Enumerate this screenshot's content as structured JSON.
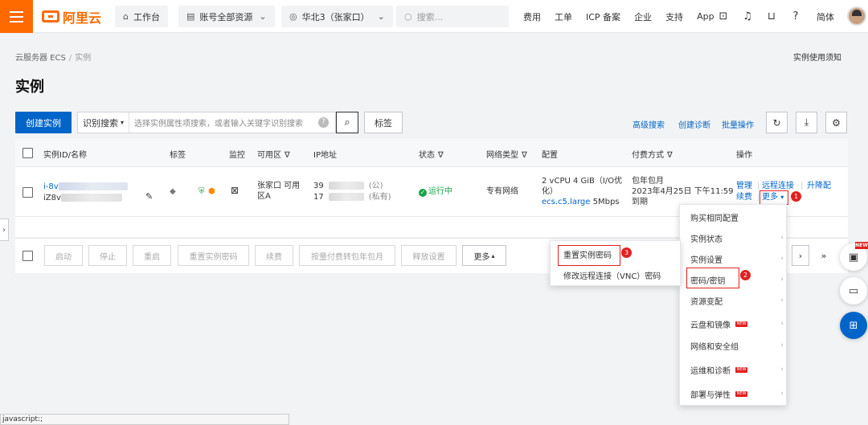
{
  "topbar": {
    "logo_text": "阿里云",
    "workbench": "工作台",
    "resources": "账号全部资源",
    "region": "华北3（张家口）",
    "search_placeholder": "搜索...",
    "links": [
      "费用",
      "工单",
      "ICP 备案",
      "企业",
      "支持",
      "App"
    ],
    "lang": "简体"
  },
  "breadcrumb": {
    "root": "云服务器 ECS",
    "sep": "/",
    "current": "实例"
  },
  "notice": "实例使用须知",
  "page_title": "实例",
  "toolbar": {
    "create": "创建实例",
    "search_select": "识别搜索",
    "search_placeholder": "选择实例属性项搜索，或者输入关键字识别搜索",
    "help": "?",
    "tag": "标签",
    "advanced": "高级搜索",
    "diagnose": "创建诊断",
    "batch": "批量操作"
  },
  "table": {
    "headers": [
      "实例ID/名称",
      "标签",
      "监控",
      "可用区",
      "IP地址",
      "状态",
      "网络类型",
      "配置",
      "付费方式",
      "操作"
    ],
    "row": {
      "id_prefix": "i-8v",
      "name_prefix": "iZ8v",
      "zone_line1": "张家口 可用",
      "zone_line2": "区A",
      "ip1_prefix": "39",
      "ip1_suffix": "(公)",
      "ip2_prefix": "17",
      "ip2_suffix": "(私有)",
      "status": "运行中",
      "network": "专有网络",
      "config_line1": "2 vCPU 4 GiB（I/O优",
      "config_line2": "化）",
      "config_type": "ecs.c5.large",
      "bandwidth": "5Mbps",
      "billing_line1": "包年包月",
      "billing_line2": "2023年4月25日 下午11:59",
      "billing_line3": "到期",
      "ops": {
        "manage": "管理",
        "remote": "远程连接",
        "upgrade": "升降配",
        "renew": "续费",
        "more": "更多"
      }
    }
  },
  "bottom_buttons": [
    "启动",
    "停止",
    "重启",
    "重置实例密码",
    "续费",
    "按量付费转包年包月",
    "释放设置",
    "更多"
  ],
  "dropdown": {
    "items": [
      {
        "label": "购买相同配置",
        "arrow": false,
        "new": false
      },
      {
        "label": "实例状态",
        "arrow": true,
        "new": false
      },
      {
        "label": "实例设置",
        "arrow": true,
        "new": false
      },
      {
        "label": "密码/密钥",
        "arrow": true,
        "new": false
      },
      {
        "label": "资源变配",
        "arrow": true,
        "new": false
      },
      {
        "label": "云盘和镜像",
        "arrow": true,
        "new": true
      },
      {
        "label": "网络和安全组",
        "arrow": true,
        "new": false
      },
      {
        "label": "运维和诊断",
        "arrow": true,
        "new": true
      },
      {
        "label": "部署与弹性",
        "arrow": true,
        "new": true
      }
    ],
    "new_label": "NEW"
  },
  "submenu": {
    "items": [
      "重置实例密码",
      "修改远程连接（VNC）密码"
    ]
  },
  "steps": [
    "1",
    "2",
    "3"
  ],
  "float_new": "NEW",
  "statusbar": "javascript:;",
  "pager": {
    "next": "›",
    "last": "»"
  }
}
